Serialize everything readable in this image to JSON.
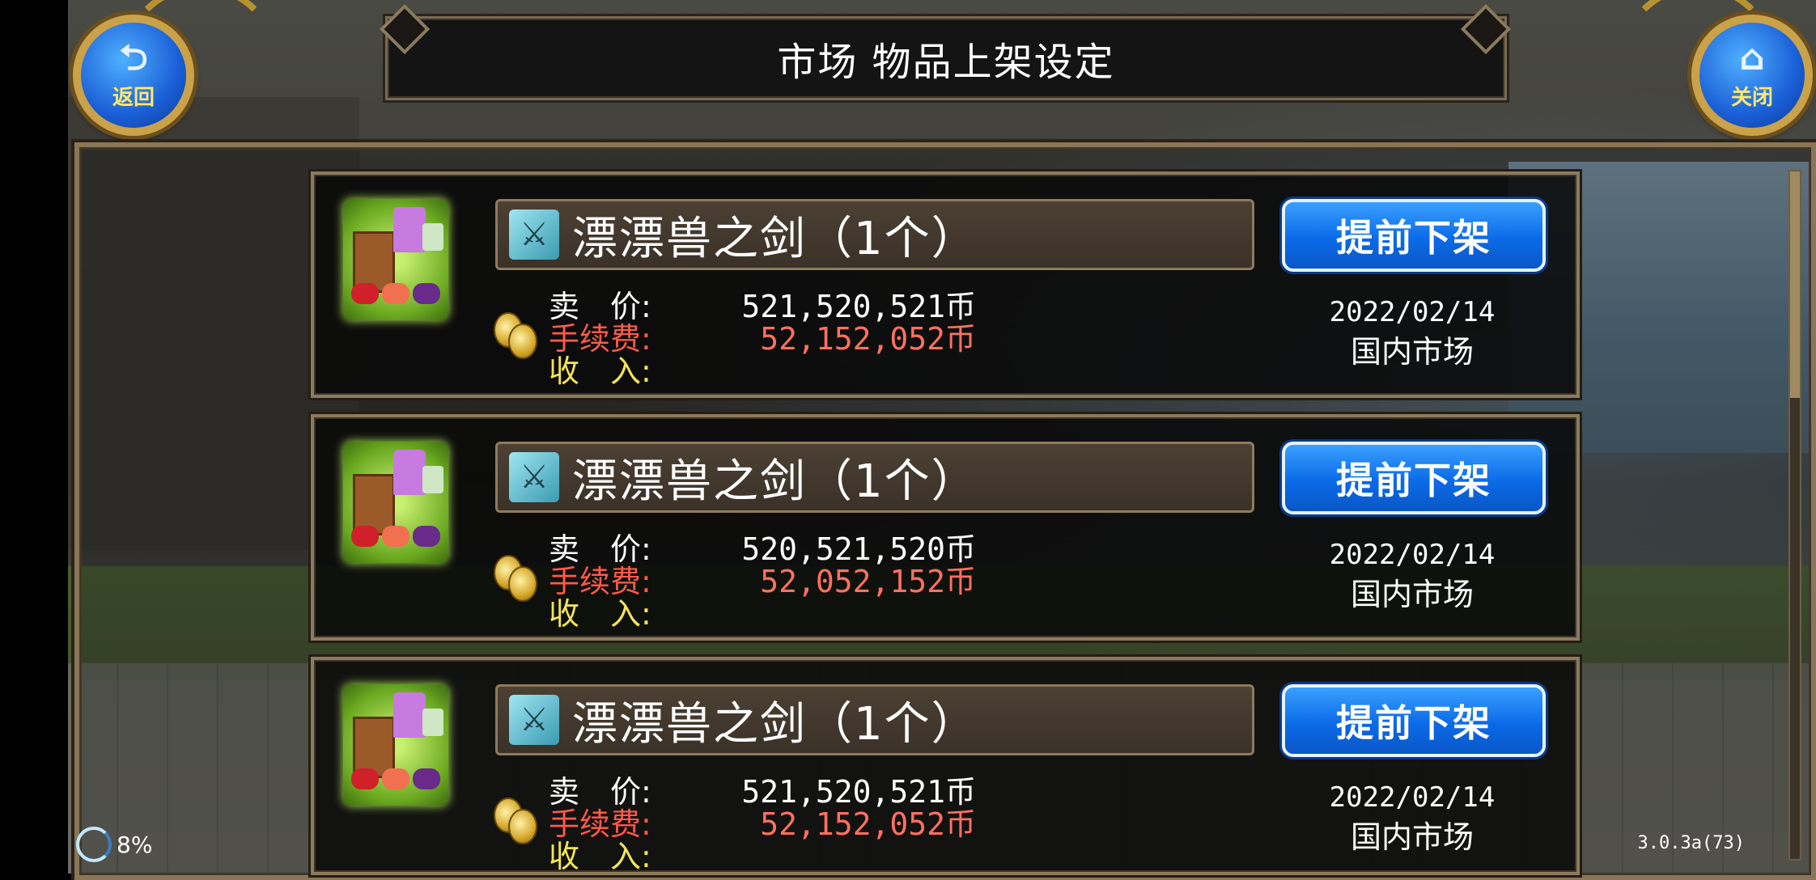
{
  "header": {
    "title": "市场 物品上架设定",
    "back_label": "返回",
    "close_label": "关闭"
  },
  "labels": {
    "price": "卖　价:",
    "fee": "手续费:",
    "income": "收　入:"
  },
  "listings": [
    {
      "item_name": "漂漂兽之剑（1个）",
      "price": "521,520,521币",
      "fee": "52,152,052币",
      "income": "",
      "button": "提前下架",
      "date": "2022/02/14",
      "market": "国内市场"
    },
    {
      "item_name": "漂漂兽之剑（1个）",
      "price": "520,521,520币",
      "fee": "52,052,152币",
      "income": "",
      "button": "提前下架",
      "date": "2022/02/14",
      "market": "国内市场"
    },
    {
      "item_name": "漂漂兽之剑（1个）",
      "price": "521,520,521币",
      "fee": "52,152,052币",
      "income": "",
      "button": "提前下架",
      "date": "2022/02/14",
      "market": "国内市场"
    }
  ],
  "footer": {
    "load_percent": "8%",
    "version": "3.0.3a(73)"
  },
  "colors": {
    "button_blue": "#0b6ae8",
    "fee_red": "#ff7060",
    "income_yellow": "#f2e45a",
    "frame_gold": "#8b7a5c"
  },
  "icons": [
    "back-arrow-icon",
    "home-icon",
    "market-stall-icon",
    "coin-icon",
    "sword-icon",
    "loading-ring-icon"
  ]
}
